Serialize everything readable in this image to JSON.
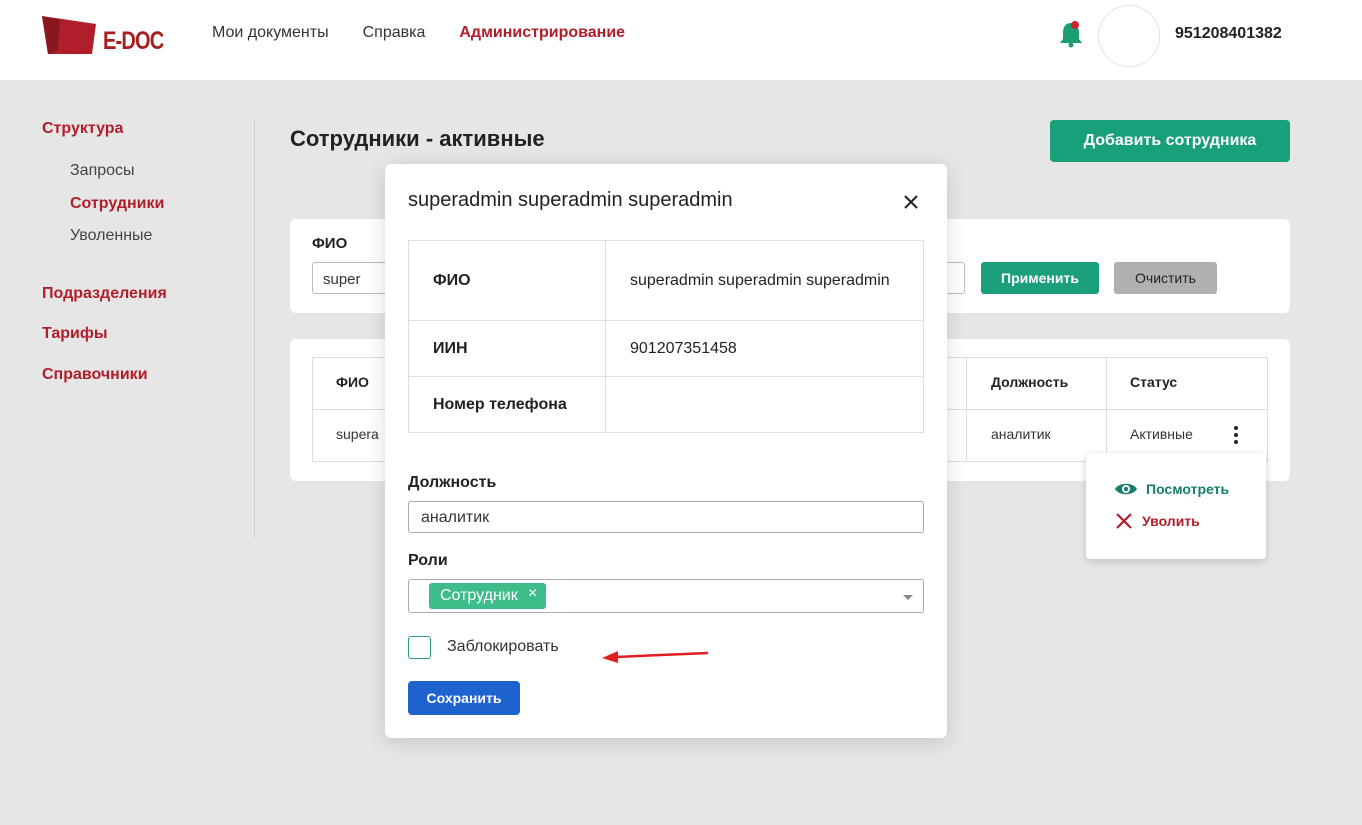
{
  "header": {
    "logo_text": "E-DOC",
    "nav": [
      "Мои документы",
      "Справка",
      "Администрирование"
    ],
    "user_phone": "951208401382"
  },
  "sidebar": {
    "structure": "Структура",
    "sub_items": [
      "Запросы",
      "Сотрудники",
      "Уволенные"
    ],
    "departments": "Подразделения",
    "tariffs": "Тарифы",
    "directories": "Справочники"
  },
  "page": {
    "title": "Сотрудники - активные",
    "add_button": "Добавить сотрудника"
  },
  "filter": {
    "label": "ФИО",
    "value": "super",
    "apply": "Применить",
    "clear": "Очистить"
  },
  "table": {
    "headers": {
      "fio": "ФИО",
      "position": "Должность",
      "status": "Статус"
    },
    "row": {
      "fio": "supera",
      "position": "аналитик",
      "status": "Активные"
    }
  },
  "context_menu": {
    "view": "Посмотреть",
    "fire": "Уволить"
  },
  "modal": {
    "title": "superadmin superadmin superadmin",
    "info": {
      "fio_label": "ФИО",
      "fio_value": "superadmin superadmin superadmin",
      "iin_label": "ИИН",
      "iin_value": "901207351458",
      "phone_label": "Номер телефона",
      "phone_value": ""
    },
    "position_label": "Должность",
    "position_value": "аналитик",
    "roles_label": "Роли",
    "role_tag": "Сотрудник",
    "block_label": "Заблокировать",
    "save_button": "Сохранить"
  },
  "colors": {
    "brand_red": "#b01e2b",
    "green": "#18a07a",
    "blue": "#1f63d1"
  }
}
